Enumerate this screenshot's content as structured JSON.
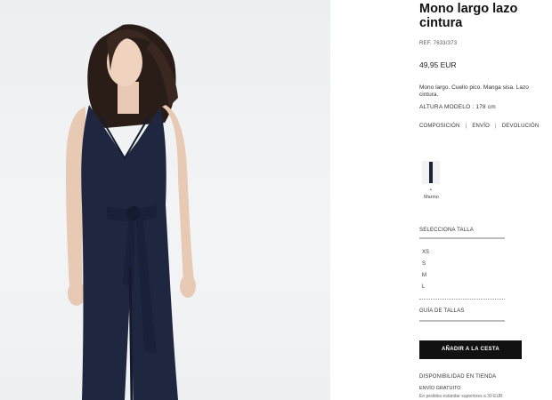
{
  "product": {
    "title_line1": "Mono largo lazo",
    "title_line2": "cintura",
    "ref": "REF. 7633/373",
    "price": "49,95 EUR",
    "description": "Mono largo. Cuello pico. Manga sisa. Lazo cintura.",
    "model_height": "ALTURA MODELO : 178 cm"
  },
  "links": {
    "composition": "COMPOSICIÓN",
    "shipping": "ENVÍO",
    "returns": "DEVOLUCIÓN",
    "separator": "|"
  },
  "color": {
    "selected_marker": "•",
    "name": "Marino",
    "swatch_hex": "#1c2238"
  },
  "sizes": {
    "title": "SELECCIONA TALLA",
    "options": [
      "XS",
      "S",
      "M",
      "L"
    ],
    "guide": "GUÍA DE TALLAS"
  },
  "actions": {
    "add_to_cart": "AÑADIR A LA CESTA"
  },
  "availability": {
    "store": "DISPONIBILIDAD EN TIENDA",
    "shipping_free": "ENVÍO GRATUITO",
    "shipping_note": "En pedidos estándar superiores a 30 EUR"
  },
  "colors": {
    "garment": "#1f2740",
    "background": "#f0f2f4",
    "button": "#111111"
  }
}
